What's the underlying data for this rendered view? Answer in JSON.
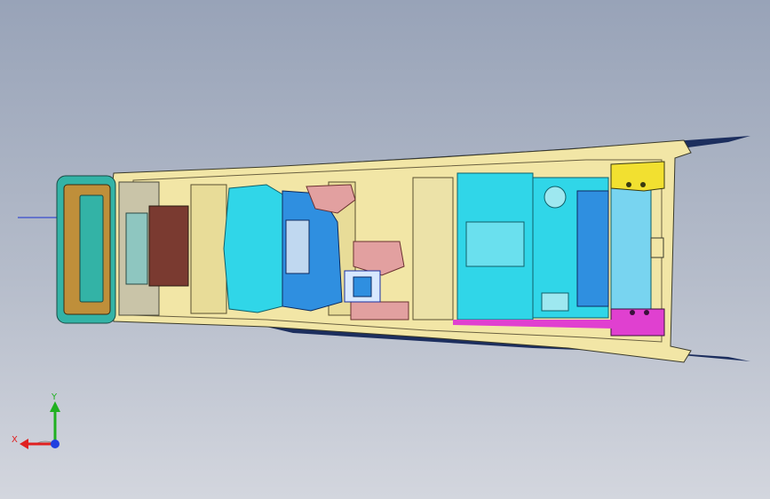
{
  "viewport": {
    "background_top": "#98a3b8",
    "background_bottom": "#d3d6de"
  },
  "model": {
    "colors": {
      "frame_cream": "#f2e6a6",
      "frame_outline": "#3a3a2a",
      "lid_teal": "#33b3a6",
      "lid_inner": "#bf8f3a",
      "cyan_part": "#30d6e8",
      "blue_part": "#2f8fe0",
      "yellow_bracket": "#f2e030",
      "magenta_bracket": "#e040d0",
      "pink_part": "#e2a0a0",
      "dark_red": "#7a3a30",
      "navy_blade": "#1c2e5e",
      "wire_blue": "#1a30d0"
    }
  },
  "triad": {
    "x_label": "X",
    "y_label": "Y",
    "x_color": "#e02020",
    "y_color": "#20b020",
    "z_color": "#2040e0"
  }
}
